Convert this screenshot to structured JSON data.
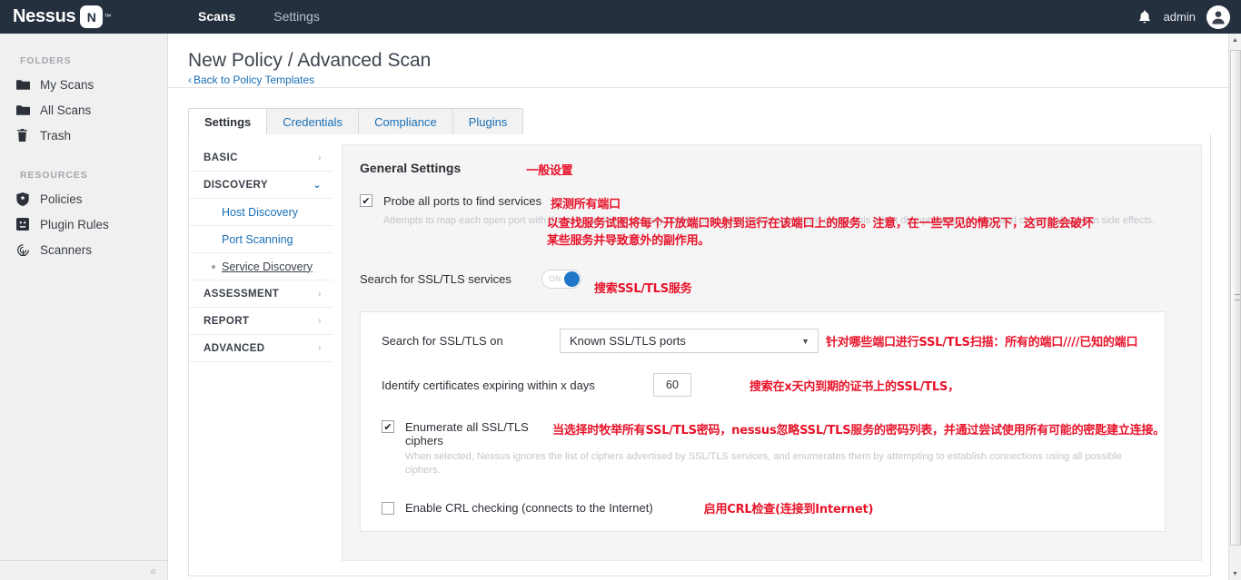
{
  "topbar": {
    "brand": "Nessus",
    "brand_badge": "N",
    "brand_tm": "™",
    "nav": [
      {
        "label": "Scans",
        "active": true
      },
      {
        "label": "Settings",
        "active": false
      }
    ],
    "bell_icon": "bell-icon",
    "user": "admin",
    "avatar_icon": "user-avatar-icon"
  },
  "sidebar": {
    "folders_title": "FOLDERS",
    "folders": [
      {
        "label": "My Scans",
        "icon": "folder-icon"
      },
      {
        "label": "All Scans",
        "icon": "folder-icon"
      },
      {
        "label": "Trash",
        "icon": "trash-icon"
      }
    ],
    "resources_title": "RESOURCES",
    "resources": [
      {
        "label": "Policies",
        "icon": "shield-icon"
      },
      {
        "label": "Plugin Rules",
        "icon": "plugin-icon"
      },
      {
        "label": "Scanners",
        "icon": "scanner-icon"
      }
    ],
    "collapse_icon": "«"
  },
  "page": {
    "title": "New Policy / Advanced Scan",
    "back_link": "Back to Policy Templates",
    "back_chevron": "‹"
  },
  "tabs": [
    {
      "label": "Settings",
      "active": true
    },
    {
      "label": "Credentials",
      "active": false
    },
    {
      "label": "Compliance",
      "active": false
    },
    {
      "label": "Plugins",
      "active": false
    }
  ],
  "settings_nav": [
    {
      "type": "head",
      "label": "BASIC",
      "arrow": "›",
      "expanded": false
    },
    {
      "type": "head",
      "label": "DISCOVERY",
      "arrow": "⌄",
      "expanded": true
    },
    {
      "type": "sub",
      "label": "Host Discovery",
      "selected": false
    },
    {
      "type": "sub",
      "label": "Port Scanning",
      "selected": false
    },
    {
      "type": "sub",
      "label": "Service Discovery",
      "selected": true
    },
    {
      "type": "head",
      "label": "ASSESSMENT",
      "arrow": "›",
      "expanded": false
    },
    {
      "type": "head",
      "label": "REPORT",
      "arrow": "›",
      "expanded": false
    },
    {
      "type": "head",
      "label": "ADVANCED",
      "arrow": "›",
      "expanded": false
    }
  ],
  "panel": {
    "title": "General Settings",
    "title_cn": "一般设置",
    "probe": {
      "label": "Probe all ports to find services",
      "label_cn": "探测所有端口",
      "checked": true,
      "check_glyph": "✔",
      "desc": "Attempts to map each open port with the service that is running on that port. Note that in some rare cases, this might disrupt some services and cause unforeseen side effects.",
      "desc_cn_line1": "以查找服务试图将每个开放端口映射到运行在该端口上的服务。注意，在一些罕见的情况下，这可能会破坏",
      "desc_cn_line2": "某些服务并导致意外的副作用。"
    },
    "ssl_toggle": {
      "label": "Search for SSL/TLS services",
      "state_text": "ON",
      "on": true,
      "label_cn": "搜索SSL/TLS服务"
    },
    "search_on": {
      "label": "Search for SSL/TLS on",
      "value": "Known SSL/TLS ports",
      "caret": "▼",
      "label_cn": "针对哪些端口进行SSL/TLS扫描：所有的端口////已知的端口"
    },
    "cert_expiry": {
      "label": "Identify certificates expiring within x days",
      "value": "60",
      "label_cn": "搜索在x天内到期的证书上的SSL/TLS，"
    },
    "enumerate": {
      "label": "Enumerate all SSL/TLS ciphers",
      "checked": true,
      "check_glyph": "✔",
      "desc": "When selected, Nessus ignores the list of ciphers advertised by SSL/TLS services, and enumerates them by attempting to establish connections using all possible ciphers.",
      "label_cn": "当选择时牧举所有SSL/TLS密码，nessus忽略SSL/TLS服务的密码列表，并通过尝试使用所有可能的密匙建立连接。"
    },
    "crl": {
      "label": "Enable CRL checking (connects to the Internet)",
      "checked": false,
      "label_cn": "启用CRL检查(连接到Internet)"
    }
  },
  "scrollbar": {
    "up_arrow": "▲",
    "down_arrow": "▼"
  },
  "colors": {
    "topbar_bg": "#25303f",
    "link_blue": "#1a6fb5",
    "accent_blue": "#2077c7",
    "annotation_red": "#e8132a"
  }
}
